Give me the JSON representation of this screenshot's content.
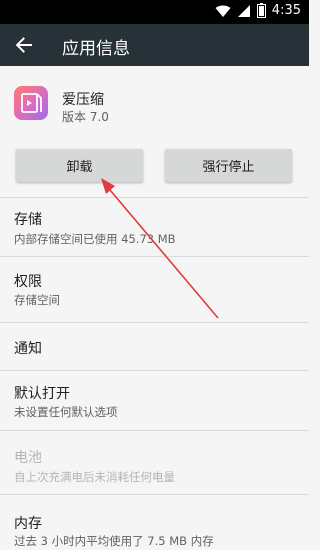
{
  "status_bar": {
    "time": "4:35",
    "icons": [
      "wifi-icon",
      "signal-icon",
      "battery-icon"
    ]
  },
  "app_bar": {
    "title": "应用信息",
    "back_icon": "arrow-back-icon"
  },
  "app": {
    "name": "爱压缩",
    "version": "版本 7.0",
    "icon": "app-compress-icon"
  },
  "buttons": {
    "uninstall": "卸载",
    "force_stop": "强行停止"
  },
  "sections": [
    {
      "key": "storage",
      "title": "存储",
      "subtitle": "内部存储空间已使用 45.73 MB",
      "enabled": true
    },
    {
      "key": "permissions",
      "title": "权限",
      "subtitle": "存储空间",
      "enabled": true
    },
    {
      "key": "notifications",
      "title": "通知",
      "subtitle": "",
      "enabled": true
    },
    {
      "key": "open_by_default",
      "title": "默认打开",
      "subtitle": "未设置任何默认选项",
      "enabled": true
    },
    {
      "key": "battery",
      "title": "电池",
      "subtitle": "自上次充满电后未消耗任何电量",
      "enabled": false
    },
    {
      "key": "memory",
      "title": "内存",
      "subtitle": "过去 3 小时内平均使用了 7.5 MB 内存",
      "enabled": true
    }
  ],
  "colors": {
    "app_bar": "#263238",
    "status_bar": "#000000",
    "background": "#f5f5f5",
    "button": "#d6d7d7",
    "annotation_arrow": "#e23b3b"
  }
}
